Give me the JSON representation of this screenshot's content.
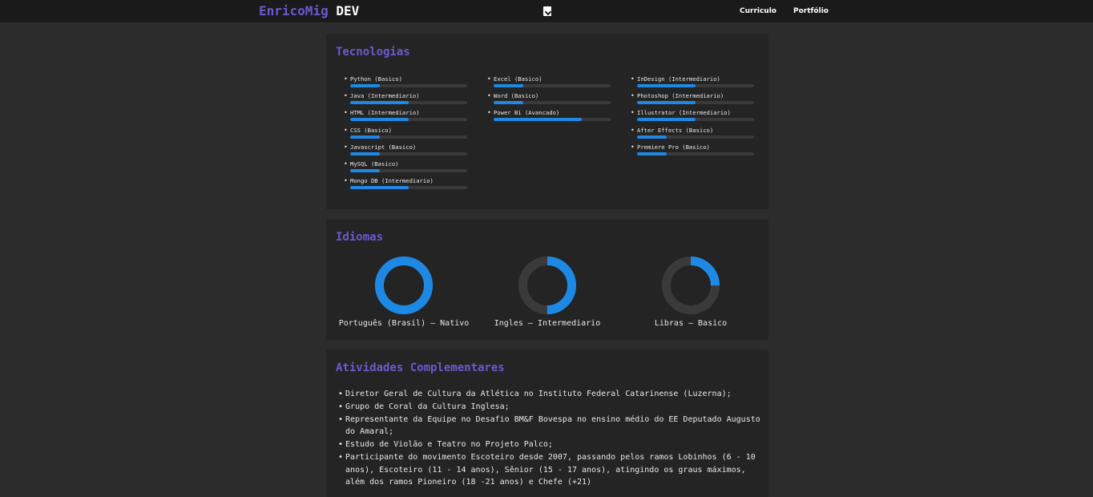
{
  "header": {
    "brand_first": "EnricoMig",
    "brand_second": "DEV",
    "brand_color": "#6a5acd",
    "download_icon": "file-download-icon",
    "nav": [
      "Curriculo",
      "Portfólio"
    ]
  },
  "tecnologias": {
    "title": "Tecnologias",
    "accent": "#1e88e5",
    "columns": [
      [
        {
          "label": "Python (Basico)",
          "level": 0.25
        },
        {
          "label": "Java (Intermediario)",
          "level": 0.5
        },
        {
          "label": "HTML (Intermediario)",
          "level": 0.5
        },
        {
          "label": "CSS (Basico)",
          "level": 0.25
        },
        {
          "label": "Javascript (Basico)",
          "level": 0.25
        },
        {
          "label": "MySQL (Basico)",
          "level": 0.25
        },
        {
          "label": "Mongo DB (Intermediario)",
          "level": 0.5
        }
      ],
      [
        {
          "label": "Excel (Basico)",
          "level": 0.25
        },
        {
          "label": "Word (Basico)",
          "level": 0.25
        },
        {
          "label": "Power Bi (Avancado)",
          "level": 0.75
        }
      ],
      [
        {
          "label": "InDesign (Intermediario)",
          "level": 0.5
        },
        {
          "label": "Photoshop (Intermediario)",
          "level": 0.5
        },
        {
          "label": "Illustrator (Intermediario)",
          "level": 0.5
        },
        {
          "label": "After Effects (Basico)",
          "level": 0.25
        },
        {
          "label": "Premiere Pro (Basico)",
          "level": 0.25
        }
      ]
    ]
  },
  "idiomas": {
    "title": "Idiomas",
    "items": [
      {
        "label": "Português (Brasil) – Nativo",
        "level": 1.0
      },
      {
        "label": "Ingles – Intermediario",
        "level": 0.5
      },
      {
        "label": "Libras – Basico",
        "level": 0.25
      }
    ]
  },
  "atividades": {
    "title": "Atividades Complementares",
    "items": [
      "Diretor Geral de Cultura da Atlética no Instituto Federal Catarinense (Luzerna);",
      "Grupo de Coral da Cultura Inglesa;",
      "Representante da Equipe no Desafio BM&F Bovespa no ensino médio do EE Deputado Augusto do Amaral;",
      "Estudo de Violão e Teatro no Projeto Palco;",
      "Participante do movimento Escoteiro desde 2007, passando pelos ramos Lobinhos (6 - 10 anos), Escoteiro (11 - 14 anos), Sênior (15 - 17 anos), atingindo os graus máximos, além dos ramos Pioneiro (18 -21 anos) e Chefe (+21)"
    ]
  }
}
